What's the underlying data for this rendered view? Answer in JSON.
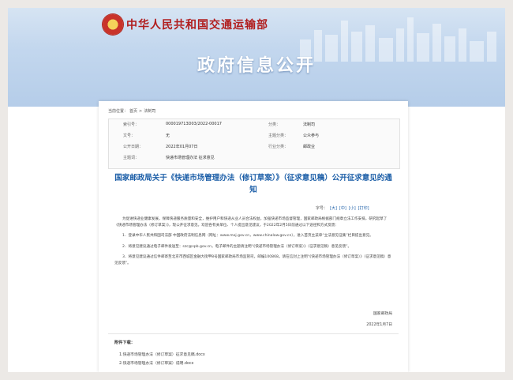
{
  "header": {
    "ministry": "中华人民共和国交通运输部",
    "banner_title": "政府信息公开"
  },
  "breadcrumb": {
    "prefix": "当前位置：",
    "items": [
      "首页",
      "法制司"
    ]
  },
  "meta": {
    "index_label": "索引号：",
    "index_value": "000019713D03/2022-00017",
    "category_label": "分类：",
    "category_value": "法制司",
    "docno_label": "文号：",
    "docno_value": "无",
    "topic_label": "主题分类：",
    "topic_value": "公众参与",
    "date_label": "公开日期：",
    "date_value": "2022年01月07日",
    "industry_label": "行业分类：",
    "industry_value": "邮政业",
    "subject_label": "主题词：",
    "subject_value": "快递市场管理办法 征求意见"
  },
  "doc": {
    "title": "国家邮政局关于《快递市场管理办法（修订草案）》（征求意见稿）公开征求意见的通知",
    "fontsize_label": "字号：",
    "fontsize_options": [
      "[大]",
      "[中]",
      "[小]",
      "[打印]"
    ],
    "paragraphs": [
      "为促进快递业健康发展，保障快递服务质量和安全，维护用户和快递从业人员合法权益，加强快递市场监督管理，国家邮政局根据部门规章立法工作安排，研究起草了《快递市场管理办法（修订草案）》，现公开征求意见。欢迎各有关单位、个人提出意见建议，于2022年2月5日前通过以下途径和方式反馈：",
      "1．登录中华人民共和国司法部 中国政府法制信息网（网址：www.moj.gov.cn，www.chinalaw.gov.cn），进入首页主菜单“立法意见征集”栏目提出意见。",
      "2．将意见建议通过电子邮件发送至：szc@spb.gov.cn，电子邮件的主题请注明“《快递市场管理办法（修订草案）》（征求意见稿）意见反馈”。",
      "3．将意见建议通过信件邮寄至北京市西城区金融大街甲8号国家邮政局市场监管司，邮编100868。请在信封上注明“《快递市场管理办法（修订草案）》（征求意见稿）意见反馈”。"
    ],
    "signer": "国家邮政局",
    "sign_date": "2022年1月7日"
  },
  "attachments": {
    "title": "附件下载：",
    "items": [
      "1.快递市场管理办法（修订草案）征求意见稿.docx",
      "2.快递市场管理办法（修订草案）说明.docx"
    ]
  }
}
